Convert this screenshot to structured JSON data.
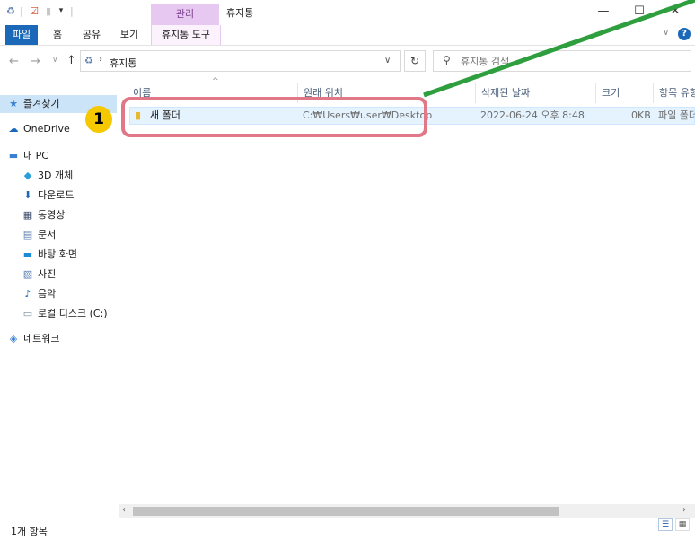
{
  "title_bar": {
    "context_tab": "관리",
    "window_title": "휴지통",
    "minimize": "—",
    "maximize": "☐",
    "close": "✕"
  },
  "ribbon": {
    "tabs": [
      "파일",
      "홈",
      "공유",
      "보기",
      "휴지통 도구"
    ],
    "help": "?"
  },
  "address": {
    "path": "휴지통"
  },
  "search": {
    "placeholder": "휴지통 검색"
  },
  "nav_pane": {
    "items": [
      {
        "label": "즐겨찾기",
        "icon": "star-icon"
      },
      {
        "label": "OneDrive",
        "icon": "cloud-icon"
      },
      {
        "label": "내 PC",
        "icon": "computer-icon"
      },
      {
        "label": "3D 개체",
        "icon": "cube-icon"
      },
      {
        "label": "다운로드",
        "icon": "download-icon"
      },
      {
        "label": "동영상",
        "icon": "video-icon"
      },
      {
        "label": "문서",
        "icon": "document-icon"
      },
      {
        "label": "바탕 화면",
        "icon": "desktop-icon"
      },
      {
        "label": "사진",
        "icon": "picture-icon"
      },
      {
        "label": "음악",
        "icon": "music-icon"
      },
      {
        "label": "로컬 디스크 (C:)",
        "icon": "disk-icon"
      },
      {
        "label": "네트워크",
        "icon": "network-icon"
      }
    ]
  },
  "columns": [
    "이름",
    "원래 위치",
    "삭제된 날짜",
    "크기",
    "항목 유형"
  ],
  "rows": [
    {
      "name": "새 폴더",
      "original_location": "C:₩Users₩user₩Desktop",
      "deleted_date": "2022-06-24 오후 8:48",
      "size": "0KB",
      "type": "파일 폴더"
    }
  ],
  "annotation": {
    "badge": "1",
    "highlight_color": "#e07888",
    "arrow_color": "#2e9e3e"
  },
  "status": {
    "item_count": "1개 항목"
  },
  "colors": {
    "accent": "#1b68b8",
    "context_tab": "#e6c8f0",
    "selection": "#e5f3ff"
  }
}
